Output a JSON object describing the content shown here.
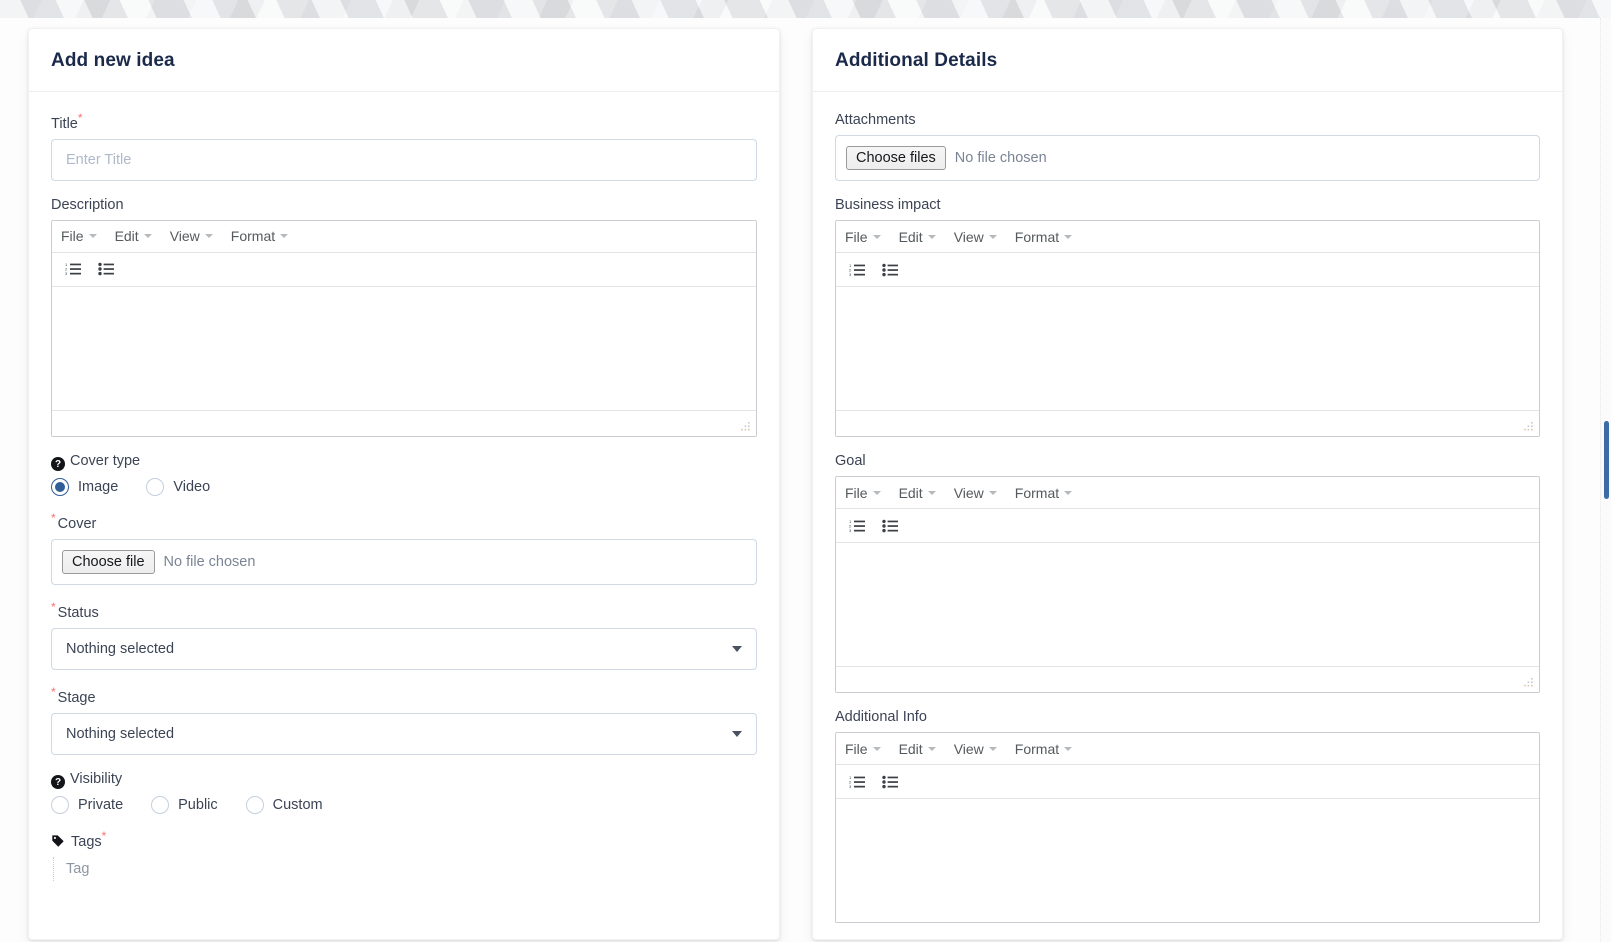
{
  "left_card": {
    "title": "Add new idea",
    "title_field": {
      "label": "Title",
      "required": true,
      "placeholder": "Enter Title",
      "value": ""
    },
    "description": {
      "label": "Description"
    },
    "cover_type": {
      "label": "Cover type",
      "help_icon": "question-circle-icon",
      "options": [
        {
          "label": "Image",
          "selected": true
        },
        {
          "label": "Video",
          "selected": false
        }
      ]
    },
    "cover": {
      "label": "Cover",
      "required": true,
      "button_label": "Choose file",
      "status_text": "No file chosen"
    },
    "status": {
      "label": "Status",
      "required": true,
      "value": "Nothing selected"
    },
    "stage": {
      "label": "Stage",
      "required": true,
      "value": "Nothing selected"
    },
    "visibility": {
      "label": "Visibility",
      "help_icon": "question-circle-icon",
      "options": [
        {
          "label": "Private",
          "selected": false
        },
        {
          "label": "Public",
          "selected": false
        },
        {
          "label": "Custom",
          "selected": false
        }
      ]
    },
    "tags": {
      "label": "Tags",
      "required": true,
      "icon": "tag-icon",
      "placeholder": "Tag",
      "value": ""
    }
  },
  "right_card": {
    "title": "Additional Details",
    "attachments": {
      "label": "Attachments",
      "button_label": "Choose files",
      "status_text": "No file chosen"
    },
    "business_impact": {
      "label": "Business impact"
    },
    "goal": {
      "label": "Goal"
    },
    "additional_info": {
      "label": "Additional Info"
    }
  },
  "editor": {
    "menus": [
      "File",
      "Edit",
      "View",
      "Format"
    ],
    "toolbar_buttons": [
      "numbered-list-icon",
      "bulleted-list-icon"
    ],
    "content": ""
  },
  "colors": {
    "card_title": "#1b2a4a",
    "label": "#3b4455",
    "required_asterisk": "#fd6f6f",
    "input_border": "#cfd8e3",
    "placeholder": "#aeb9c9",
    "radio_selected": "#2f5f96",
    "scrollbar_thumb": "#3b6ea5",
    "editor_border": "#c9ccd1"
  }
}
